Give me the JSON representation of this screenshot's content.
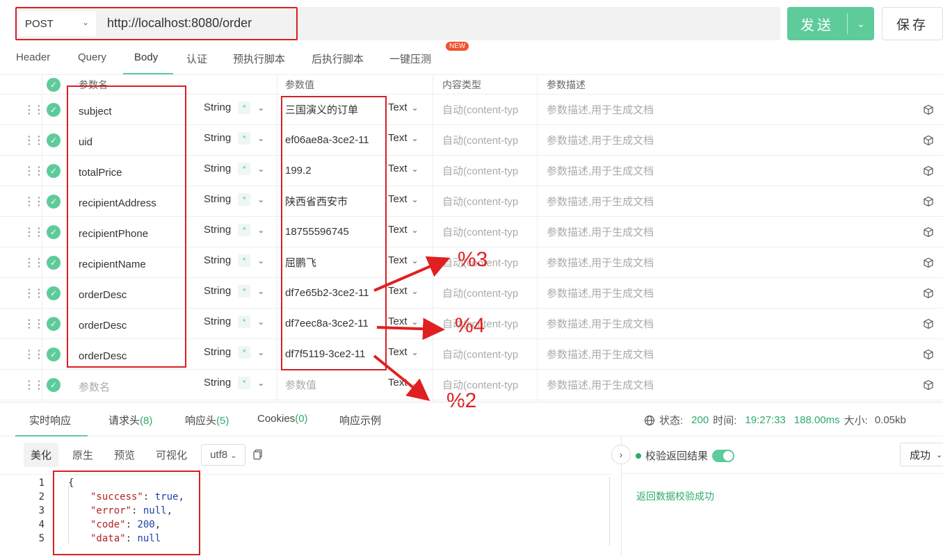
{
  "request": {
    "method": "POST",
    "url": "http://localhost:8080/order",
    "send_label": "发送",
    "save_label": "保存"
  },
  "tabs": [
    "Header",
    "Query",
    "Body",
    "认证",
    "预执行脚本",
    "后执行脚本",
    "一键压测"
  ],
  "new_badge": "NEW",
  "table": {
    "headers": {
      "name": "参数名",
      "value": "参数值",
      "content_type": "内容类型",
      "desc": "参数描述"
    },
    "rows": [
      {
        "name": "subject",
        "type": "String",
        "value": "三国演义的订单",
        "format": "Text",
        "content_type": "自动(content-typ",
        "desc": "参数描述,用于生成文档"
      },
      {
        "name": "uid",
        "type": "String",
        "value": "ef06ae8a-3ce2-11",
        "format": "Text",
        "content_type": "自动(content-typ",
        "desc": "参数描述,用于生成文档"
      },
      {
        "name": "totalPrice",
        "type": "String",
        "value": "199.2",
        "format": "Text",
        "content_type": "自动(content-typ",
        "desc": "参数描述,用于生成文档"
      },
      {
        "name": "recipientAddress",
        "type": "String",
        "value": "陕西省西安市",
        "format": "Text",
        "content_type": "自动(content-typ",
        "desc": "参数描述,用于生成文档"
      },
      {
        "name": "recipientPhone",
        "type": "String",
        "value": "18755596745",
        "format": "Text",
        "content_type": "自动(content-typ",
        "desc": "参数描述,用于生成文档"
      },
      {
        "name": "recipientName",
        "type": "String",
        "value": "屈鹏飞",
        "format": "Text",
        "content_type": "自动(content-typ",
        "desc": "参数描述,用于生成文档"
      },
      {
        "name": "orderDesc",
        "type": "String",
        "value": "df7e65b2-3ce2-11",
        "format": "Text",
        "content_type": "自动(content-typ",
        "desc": "参数描述,用于生成文档"
      },
      {
        "name": "orderDesc",
        "type": "String",
        "value": "df7eec8a-3ce2-11",
        "format": "Text",
        "content_type": "自动(content-typ",
        "desc": "参数描述,用于生成文档"
      },
      {
        "name": "orderDesc",
        "type": "String",
        "value": "df7f5119-3ce2-11",
        "format": "Text",
        "content_type": "自动(content-typ",
        "desc": "参数描述,用于生成文档"
      },
      {
        "name": "参数名",
        "type": "String",
        "value": "参数值",
        "format": "Text",
        "content_type": "自动(content-typ",
        "desc": "参数描述,用于生成文档",
        "placeholder": true
      }
    ],
    "required_mark": "*"
  },
  "annotations": [
    "%3",
    "%4",
    "%2"
  ],
  "response": {
    "tabs": [
      {
        "label": "实时响应"
      },
      {
        "label": "请求头",
        "count": "(8)"
      },
      {
        "label": "响应头",
        "count": "(5)"
      },
      {
        "label": "Cookies",
        "count": "(0)"
      },
      {
        "label": "响应示例"
      }
    ],
    "status_label": "状态:",
    "status": "200",
    "time_label": "时间:",
    "time": "19:27:33",
    "duration": "188.00ms",
    "size_label": "大小:",
    "size": "0.05kb",
    "view_tabs": [
      "美化",
      "原生",
      "预览",
      "可视化"
    ],
    "encoding": "utf8",
    "code": [
      {
        "ln": "1",
        "text": "{"
      },
      {
        "ln": "2",
        "key": "\"success\"",
        "val": "true",
        "end": ","
      },
      {
        "ln": "3",
        "key": "\"error\"",
        "val": "null",
        "end": ","
      },
      {
        "ln": "4",
        "key": "\"code\"",
        "val": "200",
        "end": ","
      },
      {
        "ln": "5",
        "key": "\"data\"",
        "val": "null",
        "end": ""
      }
    ],
    "verify_label": "校验返回结果",
    "verify_select": "成功",
    "verify_message": "返回数据校验成功"
  }
}
